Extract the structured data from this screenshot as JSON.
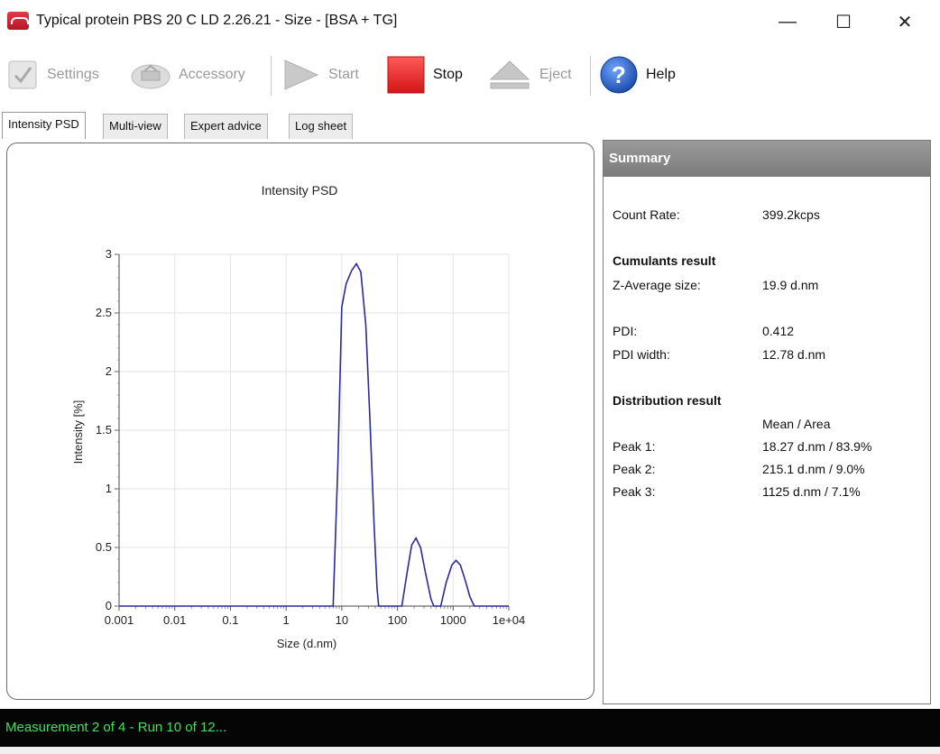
{
  "window": {
    "title": "Typical protein PBS 20 C LD 2.26.21 - Size - [BSA + TG]",
    "min_glyph": "—",
    "max_glyph": "☐",
    "close_glyph": "✕"
  },
  "toolbar": {
    "settings_label": "Settings",
    "accessory_label": "Accessory",
    "start_label": "Start",
    "stop_label": "Stop",
    "eject_label": "Eject",
    "help_label": "Help",
    "colors": {
      "stop": "#e02020",
      "disabled": "#9a9a9a",
      "help": "#1f5fc7"
    }
  },
  "tabs": [
    {
      "label": "Intensity PSD",
      "active": true
    },
    {
      "label": "Multi-view",
      "active": false
    },
    {
      "label": "Expert advice",
      "active": false
    },
    {
      "label": "Log sheet",
      "active": false
    }
  ],
  "chart_data": {
    "type": "line",
    "title": "Intensity PSD",
    "xlabel": "Size (d.nm)",
    "ylabel": "Intensity [%]",
    "x_scale": "log",
    "xlim": [
      0.001,
      10000
    ],
    "ylim": [
      0,
      3
    ],
    "x_ticks": [
      "0.001",
      "0.01",
      "0.1",
      "1",
      "10",
      "100",
      "1000",
      "1e+04"
    ],
    "y_ticks": [
      "0",
      "0.5",
      "1",
      "1.5",
      "2",
      "2.5",
      "3"
    ],
    "grid": true,
    "line_color": "#2a2a9a",
    "series": [
      {
        "points": [
          [
            0.001,
            0
          ],
          [
            7.0,
            0
          ],
          [
            8.5,
            1.2
          ],
          [
            10,
            2.55
          ],
          [
            12,
            2.75
          ],
          [
            15,
            2.86
          ],
          [
            18.3,
            2.92
          ],
          [
            22,
            2.85
          ],
          [
            27,
            2.4
          ],
          [
            32,
            1.6
          ],
          [
            38,
            0.7
          ],
          [
            43,
            0.15
          ],
          [
            46,
            0
          ],
          [
            120,
            0
          ],
          [
            145,
            0.25
          ],
          [
            180,
            0.52
          ],
          [
            215,
            0.58
          ],
          [
            260,
            0.5
          ],
          [
            320,
            0.28
          ],
          [
            400,
            0.06
          ],
          [
            450,
            0
          ],
          [
            600,
            0
          ],
          [
            750,
            0.2
          ],
          [
            950,
            0.35
          ],
          [
            1125,
            0.39
          ],
          [
            1350,
            0.35
          ],
          [
            1650,
            0.22
          ],
          [
            2000,
            0.08
          ],
          [
            2400,
            0
          ],
          [
            10000,
            0
          ]
        ]
      }
    ]
  },
  "summary": {
    "header": "Summary",
    "count_rate_label": "Count Rate:",
    "count_rate_value": "399.2kcps",
    "cumulants_heading": "Cumulants result",
    "z_avg_label": "Z-Average size:",
    "z_avg_value": "19.9 d.nm",
    "pdi_label": "PDI:",
    "pdi_value": "0.412",
    "pdi_width_label": "PDI width:",
    "pdi_width_value": "12.78 d.nm",
    "distribution_heading": "Distribution result",
    "mean_area_label": "Mean / Area",
    "peaks": [
      {
        "label": "Peak 1:",
        "value": "18.27 d.nm / 83.9%"
      },
      {
        "label": "Peak 2:",
        "value": "215.1 d.nm / 9.0%"
      },
      {
        "label": "Peak 3:",
        "value": "1125 d.nm / 7.1%"
      }
    ]
  },
  "status": {
    "text": "Measurement 2 of 4 -  Run 10 of 12...",
    "color": "#3ce35a"
  }
}
